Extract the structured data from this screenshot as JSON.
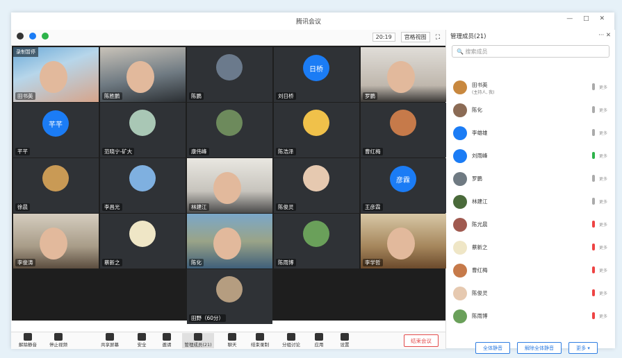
{
  "window": {
    "title": "腾讯会议"
  },
  "toolbar": {
    "time": "20:19",
    "view_label": "宫格视图",
    "win_controls": "— □ ✕"
  },
  "tiles": [
    {
      "name": "田书英",
      "type": "photo-a",
      "rec": "录制暂停"
    },
    {
      "name": "陈胜鹏",
      "type": "photo-b"
    },
    {
      "name": "陈鹏",
      "type": "img",
      "color": "#6b7a8c"
    },
    {
      "name": "刘日桥",
      "type": "avatar",
      "text": "日桥"
    },
    {
      "name": "罗鹏",
      "type": "photo-c"
    },
    {
      "name": "芊芊",
      "type": "avatar",
      "text": "芊芊"
    },
    {
      "name": "范晓宁-矿大",
      "type": "img",
      "color": "#a9c7b5"
    },
    {
      "name": "康伟峰",
      "type": "img",
      "color": "#6d8a5c"
    },
    {
      "name": "陈浩泽",
      "type": "img",
      "color": "#f0c14a"
    },
    {
      "name": "曹红梅",
      "type": "img",
      "color": "#c67a4a"
    },
    {
      "name": "徐晨",
      "type": "img",
      "color": "#c99a55"
    },
    {
      "name": "李昌光",
      "type": "img",
      "color": "#7fb0e0"
    },
    {
      "name": "林建江",
      "type": "photo-e"
    },
    {
      "name": "陈俊灵",
      "type": "img",
      "color": "#e6c9b0"
    },
    {
      "name": "王彦霖",
      "type": "avatar",
      "text": "彦霖"
    },
    {
      "name": "李俊涛",
      "type": "photo-d"
    },
    {
      "name": "蔡新之",
      "type": "img",
      "color": "#efe6c6"
    },
    {
      "name": "陈化",
      "type": "photo-f"
    },
    {
      "name": "陈雨博",
      "type": "img",
      "color": "#6aa05a"
    },
    {
      "name": "李学哲",
      "type": "photo-g"
    },
    {
      "name": "田野（60分）",
      "type": "img",
      "color": "#b59d80"
    }
  ],
  "bottom_toolbar": {
    "buttons": [
      "解除静音",
      "停止视频",
      "共享屏幕",
      "安全",
      "邀请",
      "管理成员(21)",
      "聊天",
      "结束录制",
      "分组讨论",
      "应用",
      "设置"
    ],
    "end_label": "结束会议"
  },
  "panel": {
    "title": "管理成员(21)",
    "controls": "··· ✕",
    "search_placeholder": "搜索成员",
    "members": [
      {
        "name": "田书英",
        "sub": "(主持人, 我)",
        "color": "#c8883f",
        "mic": "gray"
      },
      {
        "name": "陈化",
        "color": "#8b6b55",
        "mic": "gray"
      },
      {
        "name": "李雄雄",
        "color": "#1b7cf5",
        "mic": "gray"
      },
      {
        "name": "刘雨峰",
        "color": "#1b7cf5",
        "mic": "green"
      },
      {
        "name": "罗鹏",
        "color": "#6f7a82",
        "mic": "gray"
      },
      {
        "name": "林建江",
        "color": "#4a6a3a",
        "mic": "gray"
      },
      {
        "name": "陈光晨",
        "color": "#a05a50",
        "mic": "red"
      },
      {
        "name": "蔡新之",
        "color": "#efe6c6",
        "mic": "red"
      },
      {
        "name": "曹红梅",
        "color": "#c67a4a",
        "mic": "red"
      },
      {
        "name": "陈俊灵",
        "color": "#e6c9b0",
        "mic": "red"
      },
      {
        "name": "陈雨博",
        "color": "#6aa05a",
        "mic": "red"
      }
    ],
    "more_label": "更多",
    "mute_all": "全体静音",
    "unmute_all": "解除全体静音",
    "more_btn": "更多 ▾"
  }
}
